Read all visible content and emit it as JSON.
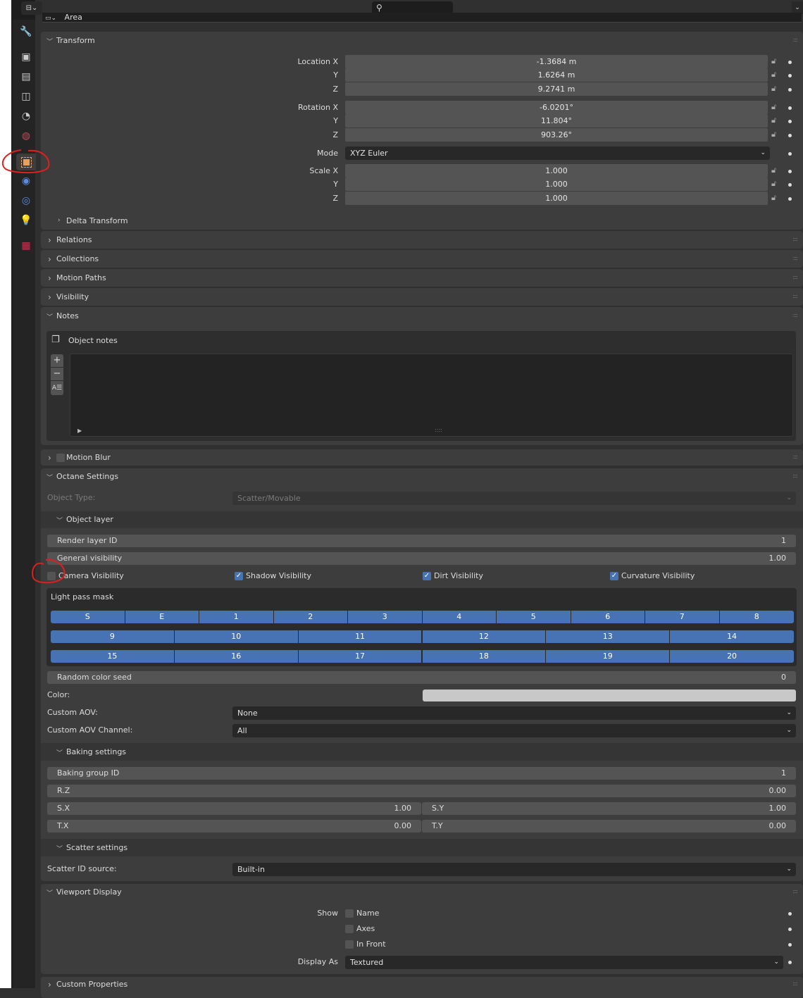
{
  "header": {
    "area_label": "Area",
    "search_placeholder": ""
  },
  "sidebar": {
    "tabs": [
      {
        "icon": "tool-icon"
      },
      {
        "icon": "render-icon"
      },
      {
        "icon": "output-icon"
      },
      {
        "icon": "view-layer-icon"
      },
      {
        "icon": "scene-icon"
      },
      {
        "icon": "world-icon"
      },
      {
        "icon": "object-icon",
        "active": true
      },
      {
        "icon": "modifier-icon"
      },
      {
        "icon": "physics-icon"
      },
      {
        "icon": "object-data-icon"
      },
      {
        "icon": "texture-icon"
      }
    ]
  },
  "transform": {
    "title": "Transform",
    "location_label": "Location X",
    "rotation_label": "Rotation X",
    "scale_label": "Scale X",
    "y": "Y",
    "z": "Z",
    "location": [
      "-1.3684 m",
      "1.6264 m",
      "9.2741 m"
    ],
    "rotation": [
      "-6.0201°",
      "11.804°",
      "903.26°"
    ],
    "mode_label": "Mode",
    "mode": "XYZ Euler",
    "scale": [
      "1.000",
      "1.000",
      "1.000"
    ],
    "delta": "Delta Transform"
  },
  "panels": {
    "relations": "Relations",
    "collections": "Collections",
    "motion_paths": "Motion Paths",
    "visibility": "Visibility",
    "notes": "Notes",
    "object_notes": "Object notes",
    "motion_blur": "Motion Blur",
    "octane": "Octane Settings",
    "viewport": "Viewport Display",
    "custom_props": "Custom Properties"
  },
  "octane": {
    "object_type_label": "Object Type:",
    "object_type": "Scatter/Movable",
    "object_layer": "Object layer",
    "render_layer_id": "Render layer ID",
    "render_layer_id_value": "1",
    "general_visibility": "General visibility",
    "general_visibility_value": "1.00",
    "checks": [
      {
        "label": "Camera Visibility",
        "checked": false
      },
      {
        "label": "Shadow Visibility",
        "checked": true
      },
      {
        "label": "Dirt Visibility",
        "checked": true
      },
      {
        "label": "Curvature Visibility",
        "checked": true
      }
    ],
    "light_pass_mask": "Light pass mask",
    "lp_row1": [
      "S",
      "E",
      "1",
      "2",
      "3",
      "4",
      "5",
      "6",
      "7",
      "8"
    ],
    "lp_row2": [
      "9",
      "10",
      "11",
      "12",
      "13",
      "14"
    ],
    "lp_row3": [
      "15",
      "16",
      "17",
      "18",
      "19",
      "20"
    ],
    "random_seed": "Random color seed",
    "random_seed_value": "0",
    "color_label": "Color:",
    "color": "#c8c8c8",
    "custom_aov_label": "Custom AOV:",
    "custom_aov": "None",
    "custom_aov_channel_label": "Custom AOV Channel:",
    "custom_aov_channel": "All",
    "baking": "Baking settings",
    "baking_group_id": "Baking group ID",
    "baking_group_id_value": "1",
    "rz": "R.Z",
    "rz_value": "0.00",
    "sx": "S.X",
    "sx_value": "1.00",
    "sy": "S.Y",
    "sy_value": "1.00",
    "tx": "T.X",
    "tx_value": "0.00",
    "ty": "T.Y",
    "ty_value": "0.00",
    "scatter": "Scatter settings",
    "scatter_id_label": "Scatter ID source:",
    "scatter_id": "Built-in"
  },
  "viewport": {
    "show_label": "Show",
    "name": "Name",
    "axes": "Axes",
    "in_front": "In Front",
    "display_as_label": "Display As",
    "display_as": "Textured"
  },
  "colors": {
    "accent": "#4772b3",
    "active_tab": "#e8a05a",
    "annotation": "#e0201c"
  }
}
